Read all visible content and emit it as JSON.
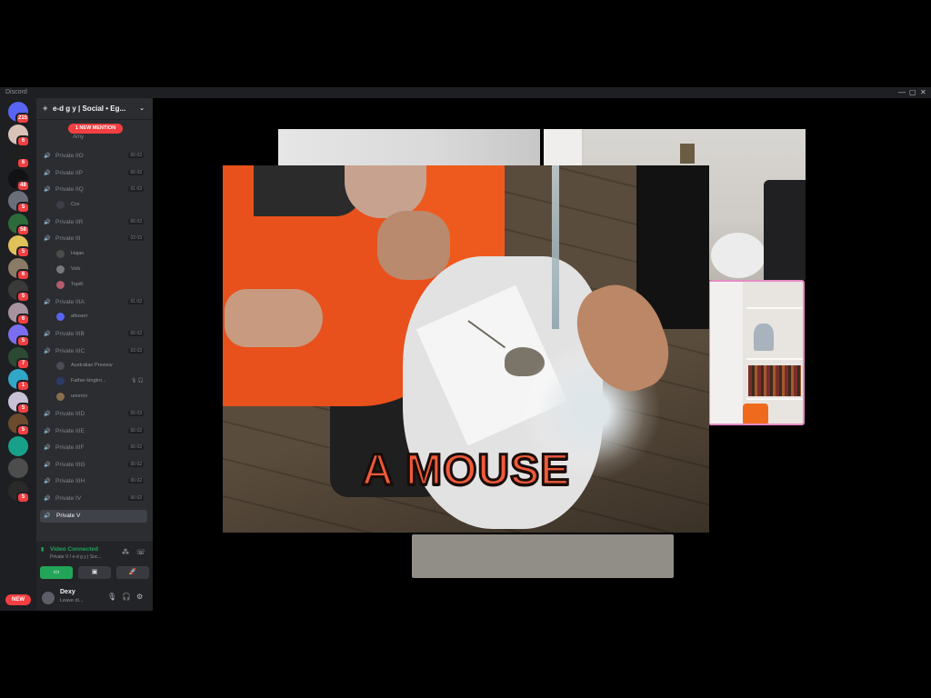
{
  "window": {
    "app_name": "Discord",
    "controls": [
      "—",
      "▢",
      "✕"
    ]
  },
  "rail": {
    "servers": [
      {
        "name": "discord-home",
        "color": "#5865f2",
        "badge": "215"
      },
      {
        "name": "server-1",
        "color": "#d9c3b8",
        "badge": "6"
      },
      {
        "name": "server-2",
        "color": "#1f1f1f",
        "badge": "6"
      },
      {
        "name": "server-3",
        "color": "#121214",
        "badge": "48"
      },
      {
        "name": "server-4",
        "color": "#6b6f7a",
        "badge": "5"
      },
      {
        "name": "server-5",
        "color": "#2e6b3a",
        "badge": "58"
      },
      {
        "name": "server-6",
        "color": "#e0c15a",
        "badge": "5"
      },
      {
        "name": "server-7",
        "color": "#8a7b66",
        "badge": "6"
      },
      {
        "name": "server-8",
        "color": "#3a3a3a",
        "badge": "5"
      },
      {
        "name": "server-9",
        "color": "#a7939f",
        "badge": "6"
      },
      {
        "name": "server-10",
        "color": "#7a6df0",
        "badge": "5"
      },
      {
        "name": "server-11",
        "color": "#2c4a33",
        "badge": "7"
      },
      {
        "name": "server-12",
        "color": "#31a6c7",
        "badge": "1"
      },
      {
        "name": "server-13",
        "color": "#c9c2d6",
        "badge": "5"
      },
      {
        "name": "server-14",
        "color": "#6b4a2e",
        "badge": "5"
      },
      {
        "name": "server-15",
        "color": "#18a08a",
        "badge": ""
      },
      {
        "name": "server-16",
        "color": "#4d4d4d",
        "badge": ""
      },
      {
        "name": "server-17",
        "color": "#2a2a2a",
        "badge": "5"
      }
    ],
    "new_label": "NEW"
  },
  "sidebar": {
    "server_name": "e-d g y | Social • Eg...",
    "mention_pill": "1 NEW MENTION",
    "top_user": "Amy",
    "channels": [
      {
        "name": "Private IIO",
        "limit": "00 02"
      },
      {
        "name": "Private IIP",
        "limit": "00 02"
      },
      {
        "name": "Private IIQ",
        "limit": "01 03",
        "users": [
          {
            "name": "Cxx",
            "color": "#3c3f45"
          }
        ]
      },
      {
        "name": "Private IIR",
        "limit": "00 02"
      },
      {
        "name": "Private III",
        "limit": "03 03",
        "users": [
          {
            "name": "Hajan",
            "color": "#4b4b4b"
          },
          {
            "name": "Vols",
            "color": "#77797e"
          },
          {
            "name": "TopiK",
            "color": "#b55b6e"
          }
        ]
      },
      {
        "name": "Private IIIA",
        "limit": "01 02",
        "users": [
          {
            "name": "aftoseri",
            "color": "#5865f2"
          }
        ]
      },
      {
        "name": "Private IIIB",
        "limit": "00 02"
      },
      {
        "name": "Private IIIC",
        "limit": "03 03",
        "users": [
          {
            "name": "Australian Preview",
            "color": "#4a4d55"
          },
          {
            "name": "Father kingtro...",
            "color": "#2b3a66",
            "icons": "🎙 🎧"
          },
          {
            "name": "unnnnn",
            "color": "#8a6e4c"
          }
        ]
      },
      {
        "name": "Private IIID",
        "limit": "00 03"
      },
      {
        "name": "Private IIIE",
        "limit": "00 02"
      },
      {
        "name": "Private IIIF",
        "limit": "00 02"
      },
      {
        "name": "Private IIIG",
        "limit": "00 02"
      },
      {
        "name": "Private IIIH",
        "limit": "00 02"
      },
      {
        "name": "Private IV",
        "limit": "00 02"
      },
      {
        "name": "Private V",
        "limit": "",
        "active": true
      }
    ]
  },
  "voice": {
    "status": "Video Connected",
    "channel": "Private V / e-d g y | Soc...",
    "buttons": [
      "▭",
      "▣",
      "🚀"
    ]
  },
  "user": {
    "name": "Dexy",
    "status": "Leave di...",
    "icons": [
      "🎙",
      "🎧",
      "⚙"
    ]
  },
  "call": {
    "caption": "A MOUSE",
    "accent_border": "#e58cc4"
  }
}
